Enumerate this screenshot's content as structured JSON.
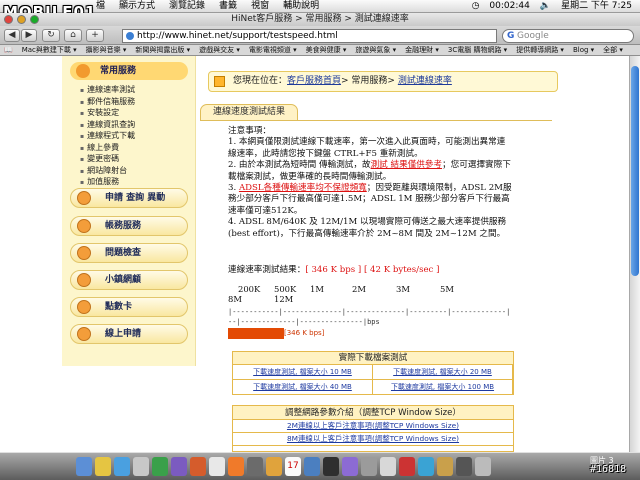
{
  "watermark": {
    "logo": "MOBILE01",
    "id": "#16818"
  },
  "menubar": {
    "menus": [
      "檔",
      "顯示方式",
      "瀏覽記錄",
      "書籤",
      "視窗",
      "輔助說明"
    ],
    "clock": "00:02:44",
    "date": "星期二 下午 7:25"
  },
  "window": {
    "title": "HiNet客戶服務 > 常用服務 > 測試連線速率"
  },
  "toolbar": {
    "url": "http://www.hinet.net/support/testspeed.html",
    "search_placeholder": "Google"
  },
  "bookmarks": [
    "Mac與數建下載 ▾",
    "攝影與音樂 ▾",
    "新聞與揭露出版 ▾",
    "遊戲與交友 ▾",
    "電影電視頻道 ▾",
    "美食與健康 ▾",
    "旅遊與氣象 ▾",
    "金融理財 ▾",
    "3C電腦 購物網路 ▾",
    "提供轉導網路 ▾",
    "Blog ▾",
    "全部 ▾"
  ],
  "sidebar": {
    "header": "常用服務",
    "items": [
      "連線速率測試",
      "郵件信箱服務",
      "安裝設定",
      "連線資訊查詢",
      "連線程式下載",
      "線上參費",
      "變更密碼",
      "網站障射台",
      "加值服務"
    ],
    "buttons": [
      "申請 查詢 異動",
      "帳務服務",
      "問題檢查",
      "小鎮網顧",
      "點數卡",
      "線上申請"
    ]
  },
  "breadcrumb": {
    "prefix": "您現在位在：",
    "home": "客戶服務首頁",
    "sep1": "> 常用服務> ",
    "current": "測試連線速率"
  },
  "section": {
    "title": "連線速度測試結果"
  },
  "notes": {
    "heading": "注意事項：",
    "n1": "1. 本網頁僅限測試連線下載速率，第一次進入此頁面時，可能測出異常連線速率，此時請您按下鍵盤 CTRL+F5 重新測試。",
    "n2a": "2. 由於本測試為短時間 傳輸測試，故",
    "n2red": "測試 結果僅供參考",
    "n2b": "；您可選擇實際下載檔案測試，做更準確的長時間傳輸測試。",
    "n3a": "3. ",
    "n3red": "ADSL各種傳輸速率均不保證頻寬",
    "n3b": "；因受距離與環境限制，ADSL 2M服務少部分客戶下行最高僅可達1.5M；ADSL 1M 服務少部分客戶下行最高速率僅可達512K。",
    "n4": "4. ADSL 8M/640K 及 12M/1M 以現場實際可傳送之最大速率提供服務(best effort)，下行最高傳輸速率介於 2M~8M 間及 2M~12M 之間。"
  },
  "result": {
    "label": "連線速率測試結果：",
    "value": "[ 346 K bps ] [ 42 K bytes/sec ]"
  },
  "scale": {
    "labels": [
      "200K",
      "500K",
      "1M",
      "2M",
      "3M",
      "5M",
      "8M",
      "12M"
    ],
    "unit": "bps",
    "rule": "|-----------|--------------|--------------|---------|-------------|",
    "rule2": "--|-------------|---------------|bps"
  },
  "speed_bar": {
    "fraction": 0.2,
    "label": "[346 K bps]"
  },
  "downloads": {
    "title": "實際下載檔案測試",
    "links": [
      "下載速度測試, 檔案大小 10 MB",
      "下載速度測試, 檔案大小 20 MB",
      "下載速度測試, 檔案大小 40 MB",
      "下載速度測試, 檔案大小 100 MB"
    ]
  },
  "tcp": {
    "title": "調整網路參數介紹（調整TCP Window Size）",
    "links": [
      "2M連線以上客戶注意事項(調整TCP Windows Size)",
      "8M連線以上客戶注意事項(調整TCP Windows Size)"
    ]
  },
  "dock": {
    "label": "圖片 3",
    "calendar_day": "17"
  },
  "colors": {
    "accent": "#d11111",
    "bar": "#e34a04",
    "link": "#1e3aa0",
    "sidebar_bg": "#fdf6cc"
  }
}
